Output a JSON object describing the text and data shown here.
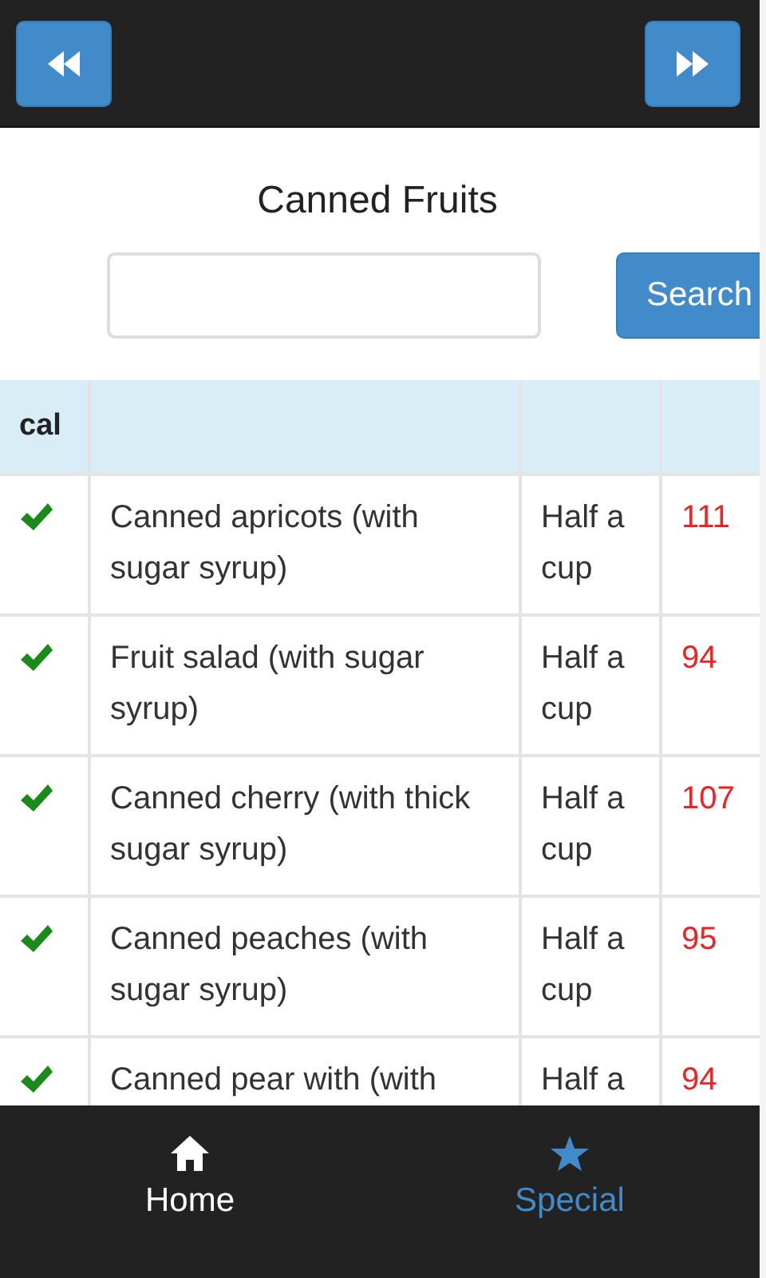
{
  "header": {
    "back_button": {
      "kind": "rewind"
    },
    "forward_button": {
      "kind": "fast-forward"
    }
  },
  "title": "Canned Fruits",
  "search": {
    "button": "Search"
  },
  "table": {
    "columns": [
      "cal"
    ],
    "rows": [
      {
        "checked": true,
        "food": "Canned apricots (with sugar syrup)",
        "portion": "Half a cup",
        "calories": "111"
      },
      {
        "checked": true,
        "food": "Fruit salad (with sugar syrup)",
        "portion": "Half a cup",
        "calories": "94"
      },
      {
        "checked": true,
        "food": "Canned cherry (with thick sugar syrup)",
        "portion": "Half a cup",
        "calories": "107"
      },
      {
        "checked": true,
        "food": "Canned peaches (with sugar syrup)",
        "portion": "Half a cup",
        "calories": "95"
      },
      {
        "checked": true,
        "food": "Canned pear with (with",
        "portion": "Half a",
        "calories": "94"
      }
    ]
  },
  "nav": [
    {
      "label": "Home",
      "kind": "home",
      "selected": false
    },
    {
      "label": "Special",
      "kind": "star",
      "selected": true
    }
  ]
}
